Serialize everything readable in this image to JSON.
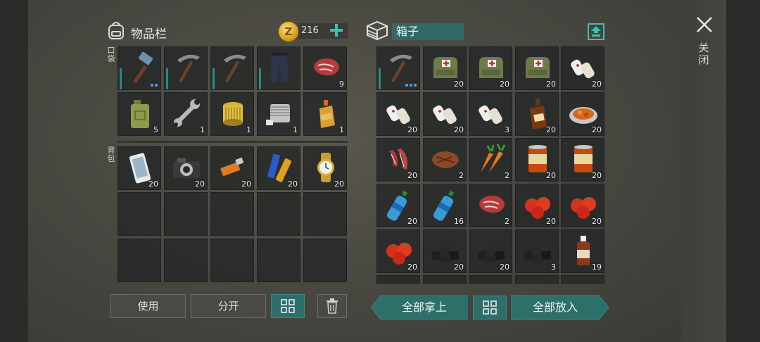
{
  "inventory": {
    "title": "物品栏",
    "coins": "216",
    "pocket_label": "口袋",
    "backpack_label": "背包"
  },
  "box": {
    "title": "箱子"
  },
  "close": {
    "label": "关闭"
  },
  "buttons": {
    "use": "使用",
    "split": "分开",
    "take_all": "全部拿上",
    "put_all": "全部放入"
  },
  "pocket_items": [
    {
      "name": "hammer",
      "count": "",
      "dots": 2,
      "durability": true
    },
    {
      "name": "pickaxe",
      "count": "",
      "dots": 0,
      "durability": true
    },
    {
      "name": "pickaxe",
      "count": "",
      "dots": 0,
      "durability": true
    },
    {
      "name": "pants",
      "count": "",
      "dots": 0,
      "durability": true
    },
    {
      "name": "raw-meat",
      "count": "9",
      "dots": 0,
      "durability": false
    },
    {
      "name": "fuel-can",
      "count": "5",
      "dots": 0,
      "durability": false
    },
    {
      "name": "wrench",
      "count": "1",
      "dots": 0,
      "durability": false
    },
    {
      "name": "air-filter",
      "count": "1",
      "dots": 0,
      "durability": false
    },
    {
      "name": "engine-part",
      "count": "1",
      "dots": 0,
      "durability": false
    },
    {
      "name": "oil-bottle",
      "count": "1",
      "dots": 0,
      "durability": false
    }
  ],
  "backpack_items": [
    {
      "name": "phone",
      "count": "20"
    },
    {
      "name": "camera",
      "count": "20"
    },
    {
      "name": "usb-drive",
      "count": "20"
    },
    {
      "name": "batteries",
      "count": "20"
    },
    {
      "name": "watch",
      "count": "20"
    }
  ],
  "box_items": [
    {
      "name": "pickaxe",
      "count": "",
      "dots": 3,
      "durability": true
    },
    {
      "name": "medkit-bag",
      "count": "20"
    },
    {
      "name": "medkit-bag",
      "count": "20"
    },
    {
      "name": "medkit-bag",
      "count": "20"
    },
    {
      "name": "bandage",
      "count": "20"
    },
    {
      "name": "bandage",
      "count": "20"
    },
    {
      "name": "bandage",
      "count": "20"
    },
    {
      "name": "bandage",
      "count": "3"
    },
    {
      "name": "whiskey",
      "count": "20"
    },
    {
      "name": "stew-plate",
      "count": "20"
    },
    {
      "name": "bacon",
      "count": "20"
    },
    {
      "name": "steak",
      "count": "2"
    },
    {
      "name": "carrots",
      "count": "2"
    },
    {
      "name": "canned-food",
      "count": "20"
    },
    {
      "name": "canned-food",
      "count": "20"
    },
    {
      "name": "water-bottle",
      "count": "20"
    },
    {
      "name": "water-bottle",
      "count": "16"
    },
    {
      "name": "raw-meat",
      "count": "2"
    },
    {
      "name": "tomatoes",
      "count": "20"
    },
    {
      "name": "tomatoes",
      "count": "20"
    },
    {
      "name": "tomatoes",
      "count": "20"
    },
    {
      "name": "coal",
      "count": "20"
    },
    {
      "name": "coal",
      "count": "20"
    },
    {
      "name": "coal",
      "count": "3"
    },
    {
      "name": "brown-bottle",
      "count": "19"
    }
  ]
}
